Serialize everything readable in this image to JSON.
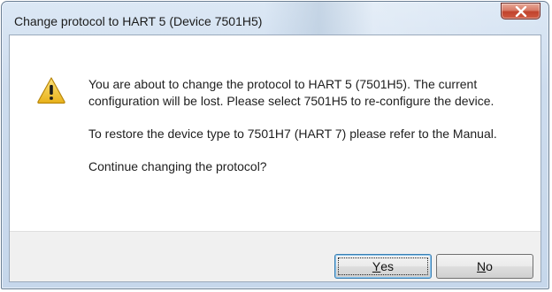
{
  "window": {
    "title": "Change protocol to HART 5 (Device 7501H5)"
  },
  "dialog": {
    "icon": "warning-icon",
    "paragraphs": [
      "You are about to change the protocol to HART 5 (7501H5). The current configuration will be lost. Please select 7501H5 to re-configure the device.",
      "To restore the device type to 7501H7 (HART 7) please refer to the Manual.",
      "Continue changing the protocol?"
    ]
  },
  "buttons": {
    "yes": {
      "mnemonic": "Y",
      "rest": "es"
    },
    "no": {
      "mnemonic": "N",
      "rest": "o"
    }
  },
  "colors": {
    "close_button": "#c94a34",
    "warning_fill": "#f3c82a",
    "default_button_border": "#3c7fb1"
  }
}
